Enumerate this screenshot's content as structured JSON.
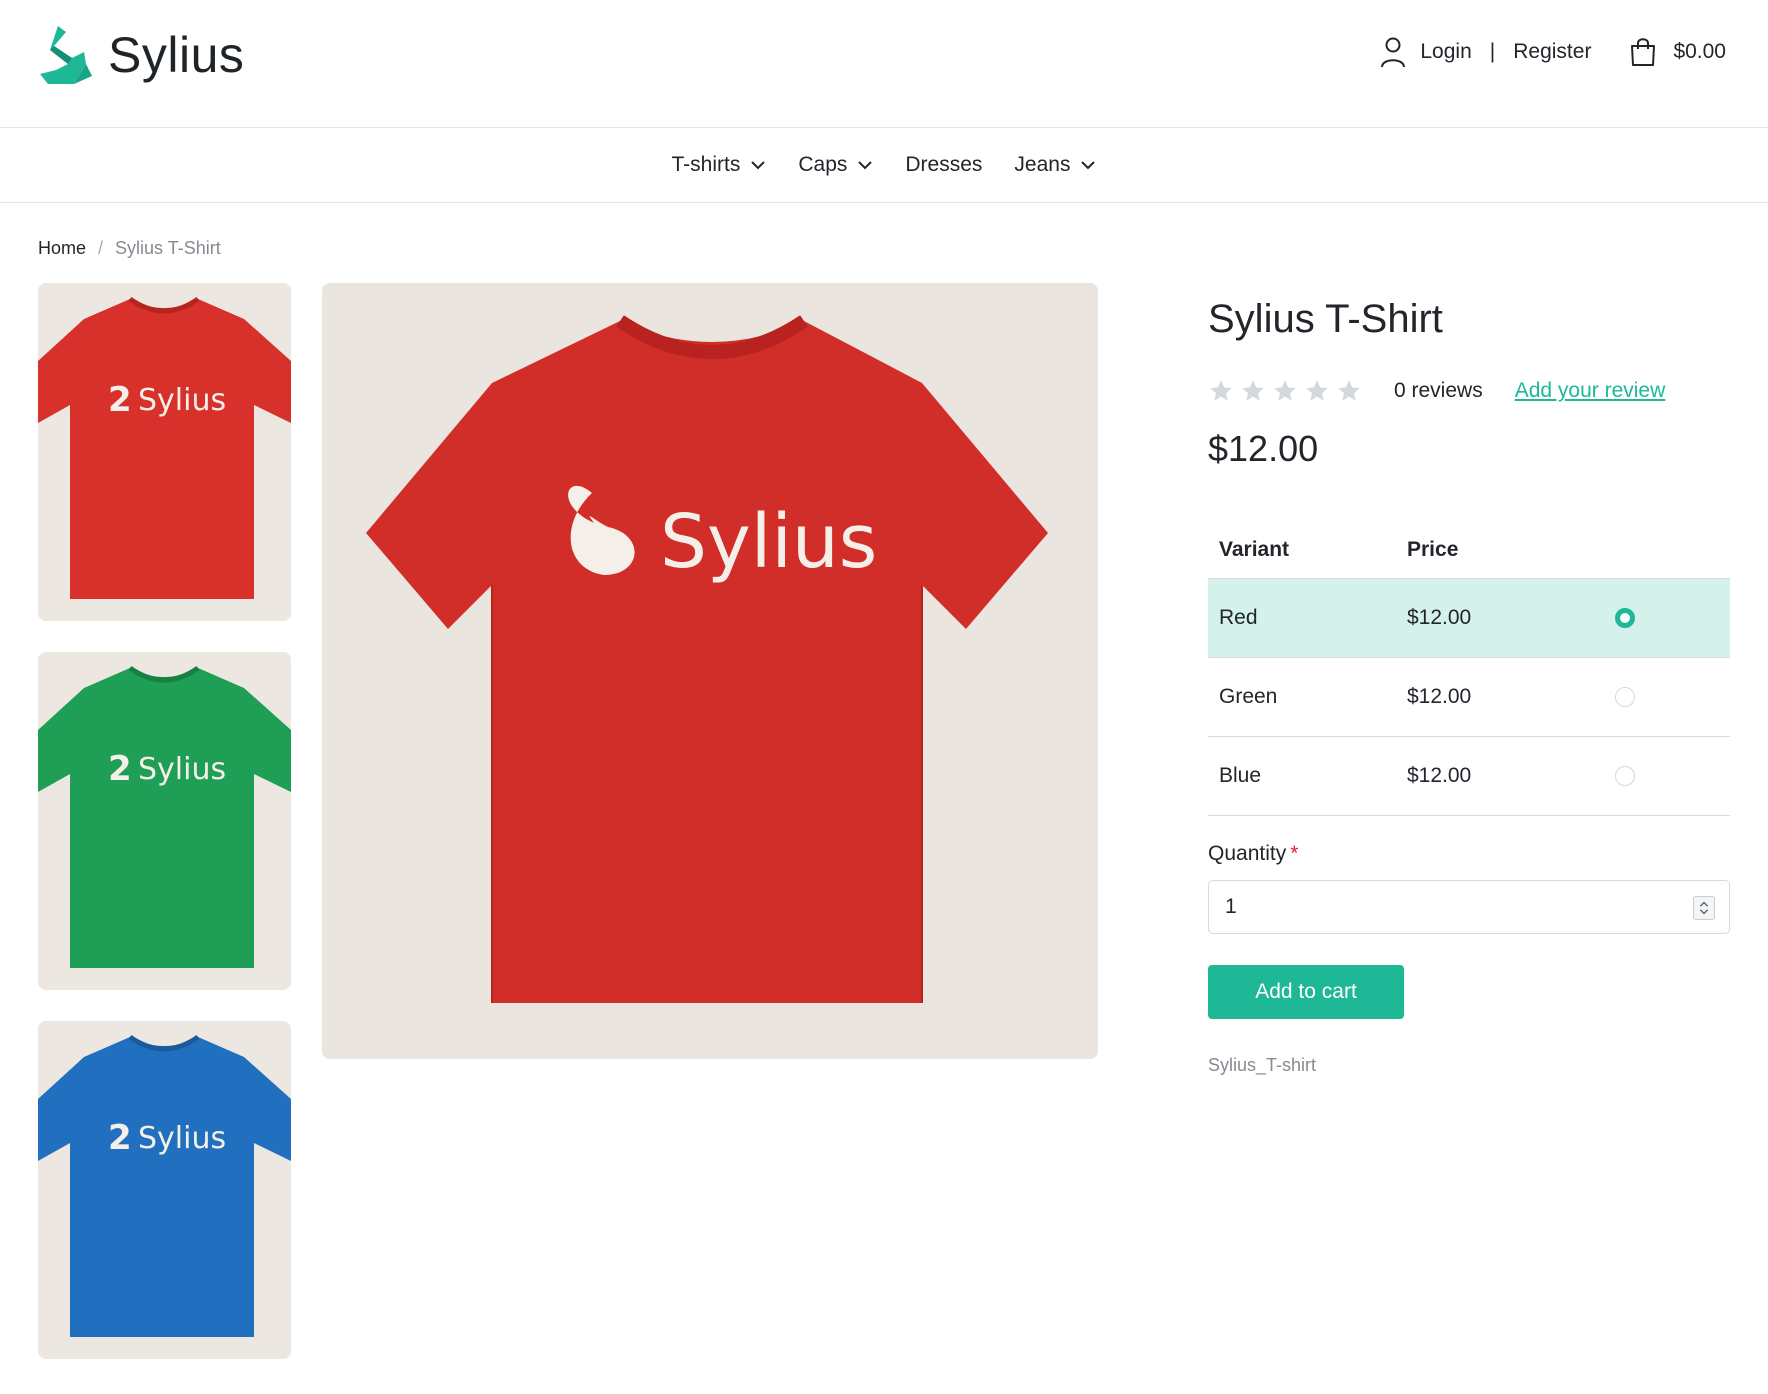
{
  "header": {
    "logo_text": "Sylius",
    "login_label": "Login",
    "separator": "|",
    "register_label": "Register",
    "cart_total": "$0.00"
  },
  "nav": {
    "items": [
      {
        "label": "T-shirts",
        "has_dropdown": true
      },
      {
        "label": "Caps",
        "has_dropdown": true
      },
      {
        "label": "Dresses",
        "has_dropdown": false
      },
      {
        "label": "Jeans",
        "has_dropdown": true
      }
    ]
  },
  "breadcrumb": {
    "home": "Home",
    "separator": "/",
    "current": "Sylius T-Shirt"
  },
  "gallery": {
    "thumbnails": [
      {
        "color_name": "red",
        "shirt_color": "#d8302b",
        "print_text": "Sylius"
      },
      {
        "color_name": "green",
        "shirt_color": "#1f9e55",
        "print_text": "Sylius"
      },
      {
        "color_name": "blue",
        "shirt_color": "#2170c0",
        "print_text": "Sylius"
      }
    ],
    "main": {
      "color_name": "red",
      "shirt_color": "#d8302b",
      "print_text": "Sylius"
    }
  },
  "product": {
    "title": "Sylius T-Shirt",
    "rating": 0,
    "rating_max": 5,
    "reviews_text": "0 reviews",
    "add_review_label": "Add your review",
    "price": "$12.00",
    "variants_header": {
      "variant": "Variant",
      "price": "Price"
    },
    "variants": [
      {
        "name": "Red",
        "price": "$12.00",
        "selected": true
      },
      {
        "name": "Green",
        "price": "$12.00",
        "selected": false
      },
      {
        "name": "Blue",
        "price": "$12.00",
        "selected": false
      }
    ],
    "quantity_label": "Quantity",
    "quantity_required_mark": "*",
    "quantity_value": "1",
    "add_to_cart_label": "Add to cart",
    "sku": "Sylius_T-shirt"
  },
  "colors": {
    "accent": "#1eb897",
    "selected_row_bg": "#d4f1eb",
    "required": "#e0203a"
  }
}
